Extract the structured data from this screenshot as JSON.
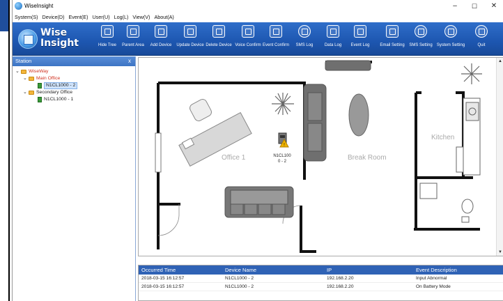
{
  "window": {
    "title": "WiseInsight",
    "controls": {
      "minimize": "–",
      "maximize": "☐",
      "close": "✕"
    }
  },
  "menu": [
    "System(S)",
    "Device(D)",
    "Event(E)",
    "User(U)",
    "Log(L)",
    "View(V)",
    "About(A)"
  ],
  "logo": {
    "line1": "Wise",
    "line2": "Insight"
  },
  "toolbar": [
    {
      "label": "Hide Tree",
      "icon": "hide-tree-icon"
    },
    {
      "label": "Parent Area",
      "icon": "parent-area-icon"
    },
    {
      "label": "Add Device",
      "icon": "add-device-icon"
    },
    {
      "label": "Update Device",
      "icon": "update-device-icon"
    },
    {
      "label": "Delete Device",
      "icon": "delete-device-icon"
    },
    {
      "label": "Voice Confirm",
      "icon": "speaker-icon"
    },
    {
      "label": "Event Confirm",
      "icon": "checkbox-icon"
    },
    {
      "label": "SMS Log",
      "icon": "chat-icon"
    },
    {
      "label": "Data Log",
      "icon": "database-icon"
    },
    {
      "label": "Event Log",
      "icon": "list-icon"
    },
    {
      "label": "Email Setting",
      "icon": "mail-icon"
    },
    {
      "label": "SMS Setting",
      "icon": "sms-icon"
    },
    {
      "label": "System Setting",
      "icon": "gear-icon"
    },
    {
      "label": "Quit",
      "icon": "power-icon"
    }
  ],
  "sidebar": {
    "title": "Station",
    "close": "x",
    "tree": [
      {
        "label": "WiseWay",
        "color": "#d0301f"
      },
      {
        "label": "Main Office",
        "color": "#d0301f"
      },
      {
        "label": "N1CL1000 - 2",
        "color": "#111111"
      },
      {
        "label": "Secondary Office",
        "color": "#111111"
      },
      {
        "label": "N1CL1000 - 1",
        "color": "#111111"
      }
    ]
  },
  "floorplan": {
    "rooms": [
      "Office 1",
      "Break Room",
      "Kitchen"
    ],
    "device": {
      "line1": "N1CL100",
      "line2": "0 - 2"
    }
  },
  "events": {
    "columns": [
      "Occurred Time",
      "Device Name",
      "IP",
      "Event Description"
    ],
    "rows": [
      [
        "2018-03-15 16:12:57",
        "N1CL1000 - 2",
        "192.168.2.20",
        "Input Abnormal"
      ],
      [
        "2018-03-15 16:12:57",
        "N1CL1000 - 2",
        "192.168.2.20",
        "On Battery Mode"
      ]
    ]
  },
  "colors": {
    "toolbar": "#1d56b0",
    "grid_header": "#2f62b5",
    "tree_selected": "#cfe3fb",
    "alert": "#f0b400"
  }
}
